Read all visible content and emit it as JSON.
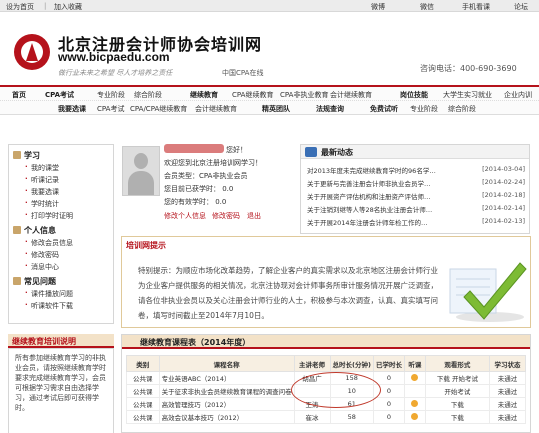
{
  "topbar": {
    "set_home": "设为首页",
    "sep": "|",
    "add_fav": "加入收藏",
    "weibo": "微博",
    "weixin": "微信",
    "mobile": "手机看课",
    "forum": "论坛"
  },
  "header": {
    "title": "北京注册会计师协会培训网",
    "url": "www.bicpaedu.com",
    "slogan": "做行业未来之希望 尽人才培养之责任",
    "cpa_online": "中国CPA在线",
    "phone": "咨询电话：400-690-3690"
  },
  "nav": {
    "row1": [
      {
        "label": "首页",
        "bold": true
      },
      {
        "label": "CPA考试",
        "bold": true
      },
      {
        "label": "专业阶段",
        "bold": false
      },
      {
        "label": "综合阶段",
        "bold": false
      },
      {
        "label": "继续教育",
        "bold": true
      },
      {
        "label": "CPA继续教育",
        "bold": false
      },
      {
        "label": "CPA非执业教育",
        "bold": false
      },
      {
        "label": "会计继续教育",
        "bold": false
      },
      {
        "label": "岗位技能",
        "bold": true
      },
      {
        "label": "大学生实习就业",
        "bold": false
      },
      {
        "label": "企业内训",
        "bold": false
      }
    ],
    "row2": [
      {
        "label": "我要选课",
        "bold": true
      },
      {
        "label": "CPA考试",
        "bold": false
      },
      {
        "label": "CPA/CPA继续教育",
        "bold": false
      },
      {
        "label": "会计继续教育",
        "bold": false
      },
      {
        "label": "精英团队",
        "bold": true
      },
      {
        "label": "法规查询",
        "bold": true
      },
      {
        "label": "免费试听",
        "bold": true
      },
      {
        "label": "专业阶段",
        "bold": false
      },
      {
        "label": "综合阶段",
        "bold": false
      }
    ]
  },
  "sidebar": {
    "study_title": "学习",
    "study_links": [
      "我的课堂",
      "听课记录",
      "我要选课",
      "学时统计",
      "打印学时证明"
    ],
    "personal_title": "个人信息",
    "personal_links": [
      "修改会员信息",
      "修改密码",
      "消息中心"
    ],
    "faq_title": "常见问题",
    "faq_links": [
      "课件播放问题",
      "听课软件下载"
    ],
    "notice_title": "继续教育培训说明",
    "notice_text": "所有参加继续教育学习的非执业会员，请按照继续教育学时要求完成继续教育学习，会员可根据学习需求自由选择学习，通过考试后即可获得学时。"
  },
  "profile": {
    "greeting": "您好！",
    "welcome": "欢迎您到北京注册培训网学习！",
    "member_type": "会员类型：CPA非执业会员",
    "current_hours": "您目前已获学时：  0.0",
    "valid_hours": "您的有效学时：  0.0",
    "edit_info": "修改个人信息",
    "edit_password": "修改密码",
    "logout": "退出"
  },
  "news": {
    "title": "最新动态",
    "items": [
      {
        "text": "对2013年度未完成继续教育学时的96名学…",
        "date": "[2014-03-04]"
      },
      {
        "text": "关于更新与完善注册会计师非执业会员学…",
        "date": "[2014-02-24]"
      },
      {
        "text": "关于开展资产评估机构和注册资产评估师…",
        "date": "[2014-02-18]"
      },
      {
        "text": "关于注销刘继等人等28名执业注册会计师…",
        "date": "[2014-02-14]"
      },
      {
        "text": "关于开展2014年注册会计师年检工作的…",
        "date": "[2014-02-13]"
      }
    ]
  },
  "tips": {
    "title": "培训网提示",
    "body": "特别提示：为顺应市场化改革趋势，了解企业客户的真实需求以及北京地区注册会计师行业为企业客户提供服务的相关情况，北京注协现对会计师事务所审计服务情况开展广泛调查，请各位非执业会员以及关心注册会计师行业的人士，积极参与本次调查，认真、真实填写问卷，填写时间截止至2014年7月10日。"
  },
  "courses": {
    "title": "继续教育课程表（2014年度）",
    "headers": [
      "类别",
      "课程名称",
      "主讲老师",
      "总时长(分钟)",
      "已学时长",
      "听课",
      "观看形式",
      "学习状态"
    ],
    "rows": [
      [
        "公共课",
        "专业英语ABC（2014）",
        "胡昌广",
        "158",
        "0",
        "",
        "下载 开始考试",
        "未通过"
      ],
      [
        "公共课",
        "关于征求非执业会员继续教育课程的调查问卷",
        "",
        "10",
        "0",
        "",
        "开始考试",
        "未通过"
      ],
      [
        "公共课",
        "高效管理技巧（2012）",
        "王涛",
        "61",
        "0",
        "",
        "下载",
        "未通过"
      ],
      [
        "公共课",
        "高效会议基本技巧（2012）",
        "崔冰",
        "58",
        "0",
        "",
        "下载",
        "未通过"
      ]
    ]
  },
  "colors": {
    "brand_red": "#b5121b",
    "nav_bg": "#fbfbfb",
    "accent_tan": "#f3e2c8"
  }
}
